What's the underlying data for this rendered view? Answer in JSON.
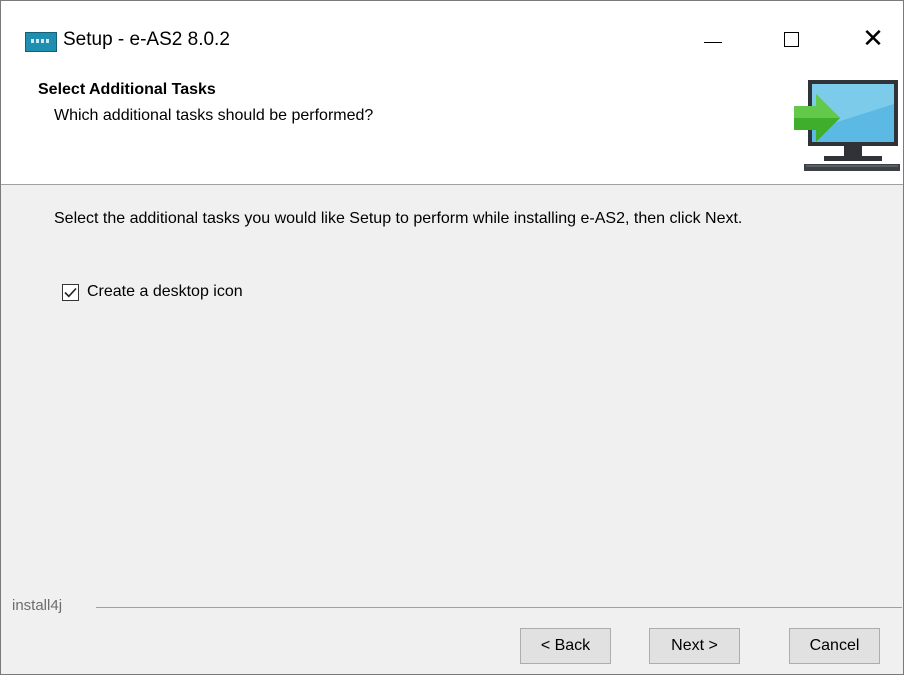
{
  "window": {
    "title": "Setup - e-AS2 8.0.2",
    "app_icon": "installer-app-icon",
    "controls": [
      "minimize-icon",
      "maximize-icon",
      "close-icon"
    ]
  },
  "header": {
    "title": "Select Additional Tasks",
    "subtitle": "Which additional tasks should be performed?",
    "graphic": "install-to-computer-icon"
  },
  "content": {
    "description": "Select the additional tasks you would like Setup to perform while installing e-AS2, then click Next.",
    "tasks": [
      {
        "label": "Create a desktop icon",
        "checked": true
      }
    ]
  },
  "footer": {
    "brand": "install4j",
    "back_label": "< Back",
    "next_label": "Next >",
    "cancel_label": "Cancel"
  },
  "colors": {
    "header_bg": "#ffffff",
    "body_bg": "#f0f0f0",
    "button_bg": "#e1e1e1",
    "arrow_green": "#3fae2a",
    "monitor_blue": "#5bb9e3"
  }
}
